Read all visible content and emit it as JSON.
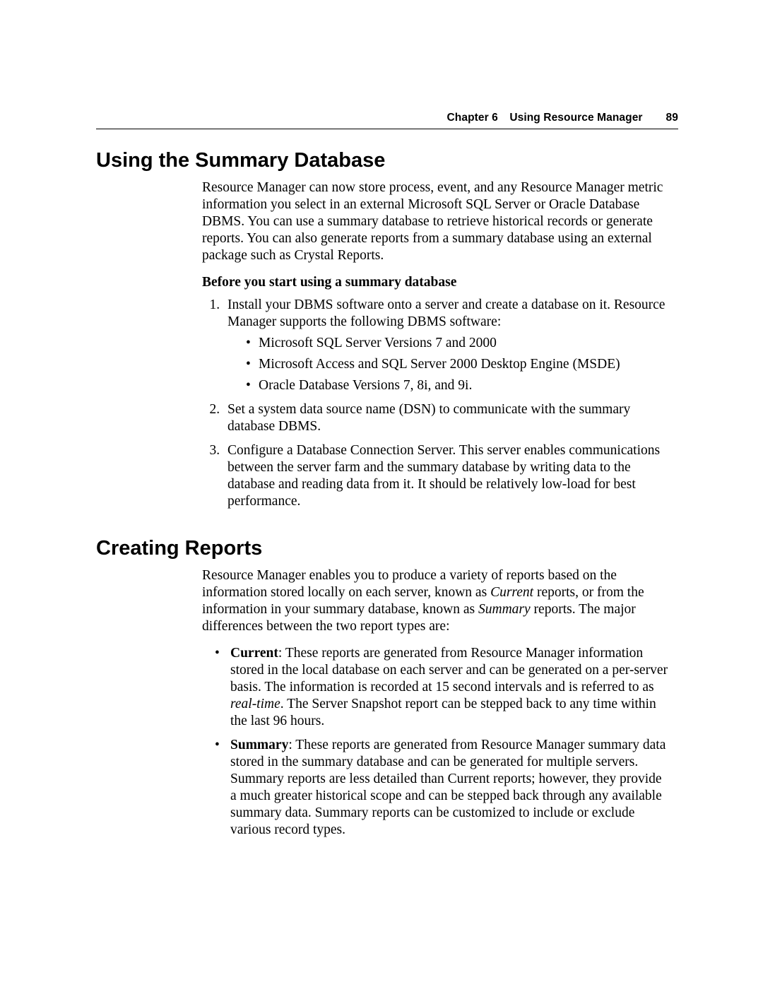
{
  "header": {
    "chapter": "Chapter 6",
    "title": "Using Resource Manager",
    "page": "89"
  },
  "section1": {
    "heading": "Using the Summary Database",
    "intro": "Resource Manager can now store process, event, and any Resource Manager metric information you select in an external Microsoft SQL Server or Oracle Database DBMS. You can use a summary database to retrieve historical records or generate reports. You can also generate reports from a summary database using an external package such as Crystal Reports.",
    "subhead": "Before you start using a summary database",
    "steps": {
      "s1_lead": "Install your DBMS software onto a server and create a database on it. Resource Manager supports the following DBMS software:",
      "s1_bullets": [
        "Microsoft SQL Server Versions 7 and 2000",
        "Microsoft Access and SQL Server 2000 Desktop Engine (MSDE)",
        "Oracle Database Versions 7, 8i, and 9i."
      ],
      "s2": "Set a system data source name (DSN) to communicate with the summary database DBMS.",
      "s3": "Configure a Database Connection Server. This server enables communications between the server farm and the summary database by writing data to the database and reading data from it. It should be relatively low-load for best performance."
    }
  },
  "section2": {
    "heading": "Creating Reports",
    "intro": {
      "pre": "Resource Manager enables you to produce a variety of reports based on the information stored locally on each server, known as ",
      "i1": "Current",
      "mid1": " reports, or from the information in your summary database, known as ",
      "i2": "Summary",
      "post": " reports. The major differences between the two report types are:"
    },
    "bullets": {
      "b1": {
        "label": "Current",
        "pre": ": These reports are generated from Resource Manager information stored in the local database on each server and can be generated on a per-server basis. The information is recorded at 15 second intervals and is referred to as ",
        "i1": "real-time",
        "post": ". The Server Snapshot report can be stepped back to any time within the last 96 hours."
      },
      "b2": {
        "label": "Summary",
        "text": ": These reports are generated from Resource Manager summary data stored in the summary database and can be generated for multiple servers. Summary reports are less detailed than Current reports; however, they provide a much greater historical scope and can be stepped back through any available summary data. Summary reports can be customized to include or exclude various record types."
      }
    }
  }
}
